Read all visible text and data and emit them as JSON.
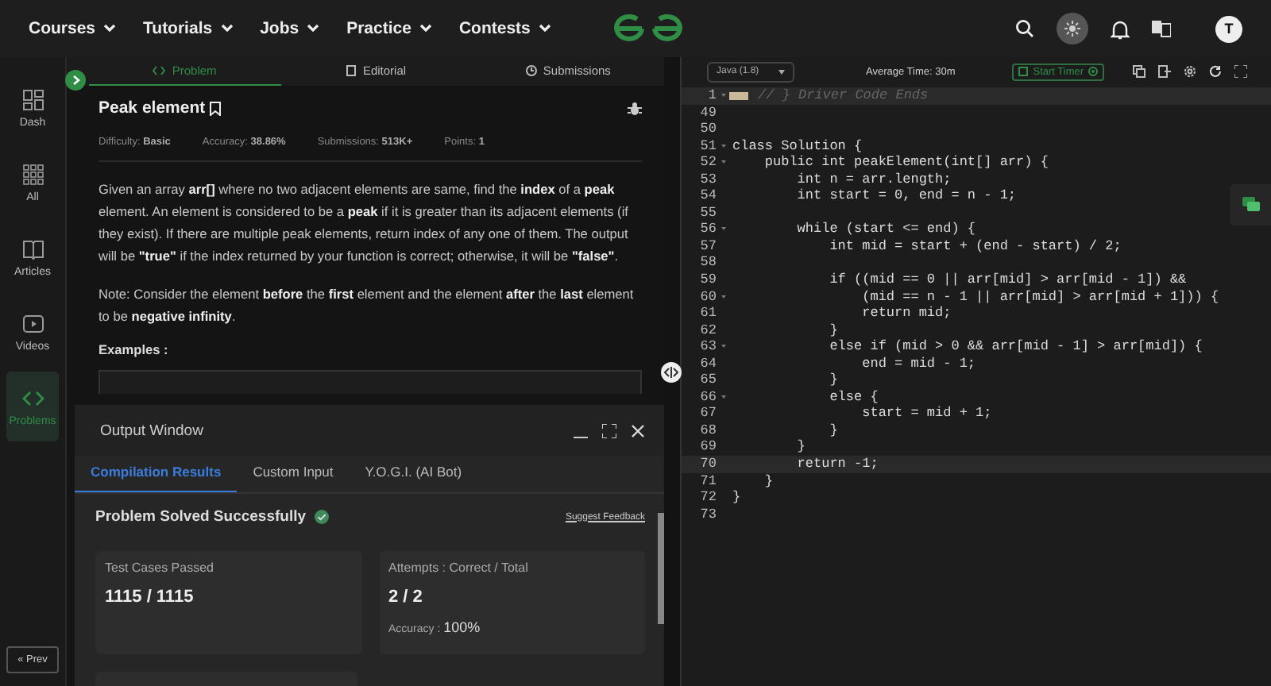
{
  "nav": {
    "menus": [
      {
        "label": "Courses"
      },
      {
        "label": "Tutorials"
      },
      {
        "label": "Jobs"
      },
      {
        "label": "Practice"
      },
      {
        "label": "Contests"
      }
    ],
    "avatar": "T"
  },
  "sidebar": {
    "items": [
      {
        "label": "Dash",
        "selected": false
      },
      {
        "label": "All",
        "selected": false
      },
      {
        "label": "Articles",
        "selected": false
      },
      {
        "label": "Videos",
        "selected": false
      },
      {
        "label": "Problems",
        "selected": true
      }
    ],
    "prev": "« Prev"
  },
  "problem_tabs": [
    {
      "label": "Problem",
      "selected": true
    },
    {
      "label": "Editorial",
      "selected": false
    },
    {
      "label": "Submissions",
      "selected": false
    }
  ],
  "problem": {
    "title": "Peak element",
    "meta": [
      {
        "label": "Difficulty:",
        "value": "Basic"
      },
      {
        "label": "Accuracy:",
        "value": "38.86%"
      },
      {
        "label": "Submissions:",
        "value": "513K+"
      },
      {
        "label": "Points:",
        "value": "1"
      }
    ],
    "paragraphs": [
      "Given an array **arr[]** where no two adjacent elements are same, find the **index** of a **peak** element. An element is considered to be a **peak** if it is greater than its adjacent elements (if they exist). If there are multiple peak elements, return index of any one of them. The output will be **\"true\"** if the index returned by your function is correct; otherwise, it will be **\"false\"**.",
      "Note: Consider the element **before** the **first** element and the element **after** the **last** element to be **negative infinity**."
    ],
    "examples_heading": "Examples :"
  },
  "output_window": {
    "title": "Output Window",
    "tabs": [
      {
        "label": "Compilation Results",
        "selected": true
      },
      {
        "label": "Custom Input",
        "selected": false
      },
      {
        "label": "Y.O.G.I. (AI Bot)",
        "selected": false
      }
    ],
    "status": "Problem Solved Successfully",
    "feedback_link": "Suggest Feedback",
    "cards": [
      {
        "label": "Test Cases Passed",
        "value": "1115 / 1115"
      },
      {
        "label": "Attempts : Correct / Total",
        "value": "2 / 2",
        "note_label": "Accuracy :",
        "note_value": "100%"
      }
    ]
  },
  "editor": {
    "language": "Java (1.8)",
    "average_time": "Average Time: 30m",
    "timer_button": "Start Timer",
    "lines": [
      {
        "number": "1",
        "code": "// } Driver Code Ends",
        "kind": "comment",
        "fold": true,
        "highlighted": true
      },
      {
        "number": "49",
        "kind": "code",
        "fold": false,
        "highlighted": false
      },
      {
        "number": "50",
        "kind": "code",
        "fold": false,
        "highlighted": false
      },
      {
        "number": "51",
        "code": "class Solution {",
        "kind": "code",
        "fold": true,
        "highlighted": false
      },
      {
        "number": "52",
        "code": "    public int peakElement(int[] arr) {",
        "kind": "code",
        "fold": true,
        "highlighted": false
      },
      {
        "number": "53",
        "code": "        int n = arr.length;",
        "kind": "code",
        "fold": false,
        "highlighted": false
      },
      {
        "number": "54",
        "code": "        int start = 0, end = n - 1;",
        "kind": "code",
        "fold": false,
        "highlighted": false
      },
      {
        "number": "55",
        "kind": "code",
        "fold": false,
        "highlighted": false
      },
      {
        "number": "56",
        "code": "        while (start <= end) {",
        "kind": "code",
        "fold": true,
        "highlighted": false
      },
      {
        "number": "57",
        "code": "            int mid = start + (end - start) / 2;",
        "kind": "code",
        "fold": false,
        "highlighted": false
      },
      {
        "number": "58",
        "kind": "code",
        "fold": false,
        "highlighted": false
      },
      {
        "number": "59",
        "code": "            if ((mid == 0 || arr[mid] > arr[mid - 1]) &&",
        "kind": "code",
        "fold": false,
        "highlighted": false
      },
      {
        "number": "60",
        "code": "                (mid == n - 1 || arr[mid] > arr[mid + 1])) {",
        "kind": "code",
        "fold": true,
        "highlighted": false
      },
      {
        "number": "61",
        "code": "                return mid;",
        "kind": "code",
        "fold": false,
        "highlighted": false
      },
      {
        "number": "62",
        "code": "            }",
        "kind": "code",
        "fold": false,
        "highlighted": false
      },
      {
        "number": "63",
        "code": "            else if (mid > 0 && arr[mid - 1] > arr[mid]) {",
        "kind": "code",
        "fold": true,
        "highlighted": false
      },
      {
        "number": "64",
        "code": "                end = mid - 1;",
        "kind": "code",
        "fold": false,
        "highlighted": false
      },
      {
        "number": "65",
        "code": "            }",
        "kind": "code",
        "fold": false,
        "highlighted": false
      },
      {
        "number": "66",
        "code": "            else {",
        "kind": "code",
        "fold": true,
        "highlighted": false
      },
      {
        "number": "67",
        "code": "                start = mid + 1;",
        "kind": "code",
        "fold": false,
        "highlighted": false
      },
      {
        "number": "68",
        "code": "            }",
        "kind": "code",
        "fold": false,
        "highlighted": false
      },
      {
        "number": "69",
        "code": "        }",
        "kind": "code",
        "fold": false,
        "highlighted": false
      },
      {
        "number": "70",
        "code": "        return -1;",
        "kind": "code",
        "fold": false,
        "highlighted": true
      },
      {
        "number": "71",
        "code": "    }",
        "kind": "code",
        "fold": false,
        "highlighted": false
      },
      {
        "number": "72",
        "code": "}",
        "kind": "code",
        "fold": false,
        "highlighted": false
      },
      {
        "number": "73",
        "kind": "code",
        "fold": false,
        "highlighted": false
      }
    ]
  }
}
